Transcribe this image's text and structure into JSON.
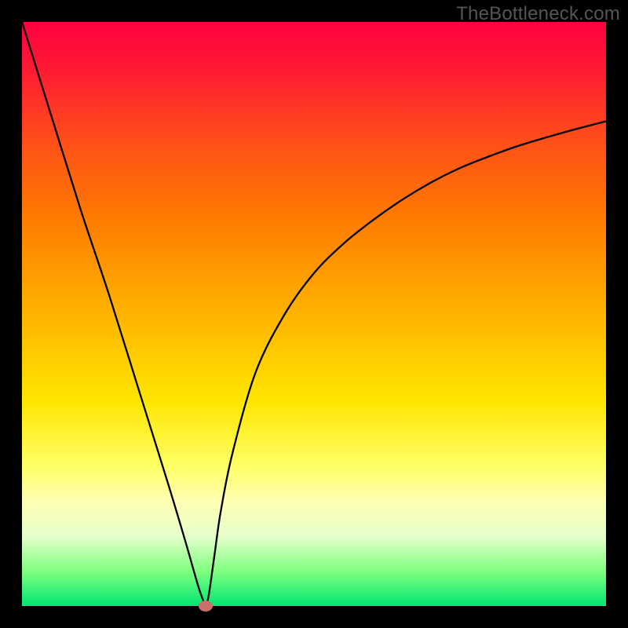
{
  "watermark": "TheBottleneck.com",
  "chart_data": {
    "type": "line",
    "title": "",
    "xlabel": "",
    "ylabel": "",
    "xlim": [
      0,
      100
    ],
    "ylim": [
      0,
      100
    ],
    "grid": false,
    "series": [
      {
        "name": "curve",
        "x": [
          0,
          5,
          10,
          15,
          20,
          25,
          28,
          30,
          31,
          31.5,
          32,
          33,
          34,
          36,
          40,
          45,
          50,
          55,
          60,
          65,
          70,
          75,
          80,
          85,
          90,
          95,
          100
        ],
        "y": [
          100,
          84,
          68,
          53,
          37,
          21,
          11,
          4,
          1,
          0,
          2,
          9,
          16,
          26,
          40,
          50,
          57,
          62,
          66,
          69.5,
          72.5,
          75,
          77,
          78.8,
          80.3,
          81.7,
          83
        ],
        "color": "#000000",
        "stroke_width": 2.3
      }
    ],
    "marker": {
      "x": 31.5,
      "y": 0,
      "color": "#c9706c"
    },
    "background_gradient": {
      "direction": "vertical",
      "stops": [
        {
          "pos": 0,
          "color": "#ff0040"
        },
        {
          "pos": 35,
          "color": "#ff8000"
        },
        {
          "pos": 65,
          "color": "#ffe600"
        },
        {
          "pos": 88,
          "color": "#e6ffcc"
        },
        {
          "pos": 100,
          "color": "#00e673"
        }
      ]
    }
  }
}
